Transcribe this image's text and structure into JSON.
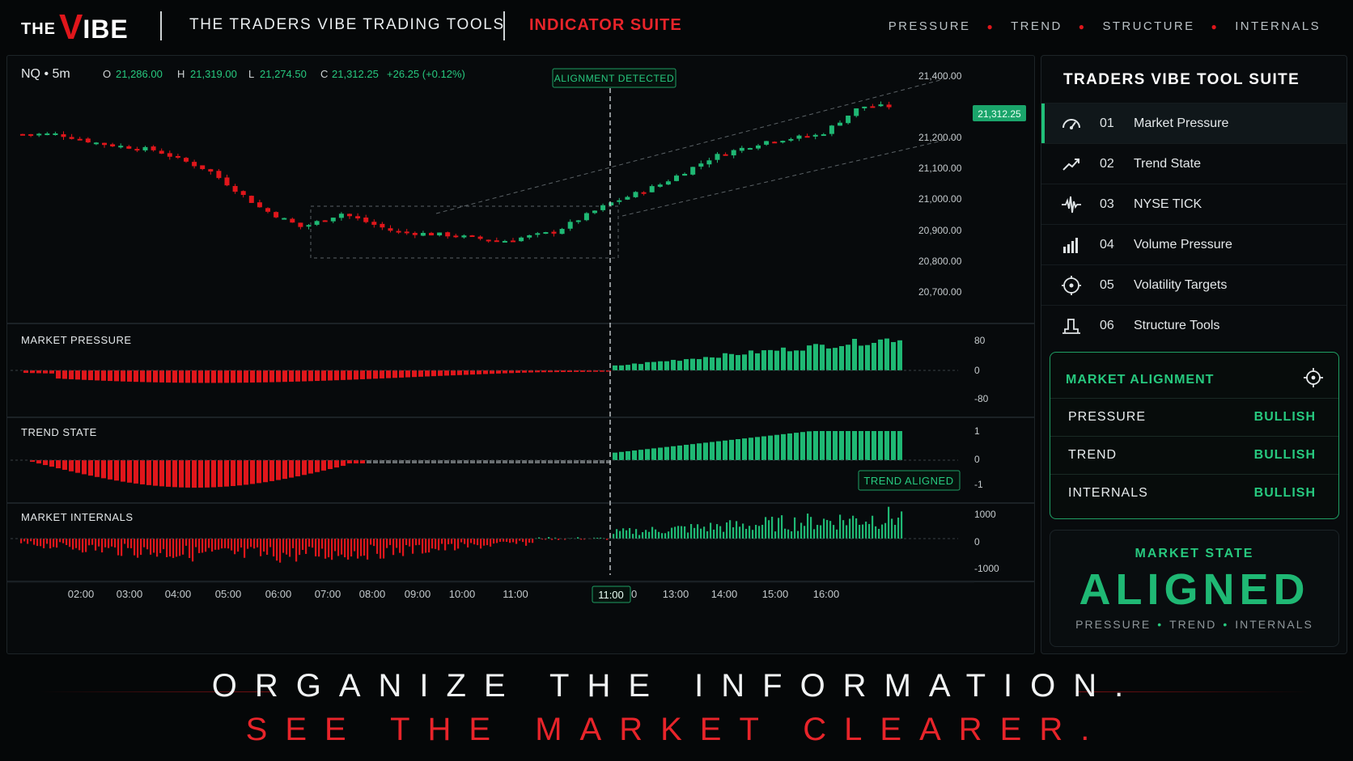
{
  "brand": {
    "logo_the": "THE",
    "logo_v": "V",
    "logo_ibe": "IBE",
    "title": "THE TRADERS VIBE TRADING TOOLS",
    "suite": "INDICATOR SUITE"
  },
  "nav": [
    "PRESSURE",
    "TREND",
    "STRUCTURE",
    "INTERNALS"
  ],
  "chart": {
    "symbol": "NQ • 5m",
    "ohlc": {
      "o_label": "O",
      "o": "21,286.00",
      "h_label": "H",
      "h": "21,319.00",
      "l_label": "L",
      "l": "21,274.50",
      "c_label": "C",
      "c": "21,312.25",
      "change": "+26.25 (+0.12%)"
    },
    "alignment_tag": "ALIGNMENT DETECTED",
    "last_price": "21,312.25",
    "price_ticks": [
      "21,400.00",
      "21,200.00",
      "21,100.00",
      "21,000.00",
      "20,900.00",
      "20,800.00",
      "20,700.00"
    ],
    "time_ticks": [
      "02:00",
      "03:00",
      "04:00",
      "05:00",
      "06:00",
      "07:00",
      "08:00",
      "09:00",
      "10:00",
      "11:00",
      "12:00",
      "13:00",
      "14:00",
      "15:00",
      "16:00"
    ],
    "current_time": "11:00",
    "panels": [
      {
        "title": "MARKET PRESSURE",
        "ticks": [
          "80",
          "0",
          "-80"
        ]
      },
      {
        "title": "TREND STATE",
        "ticks": [
          "1",
          "0",
          "-1"
        ],
        "badge": "TREND ALIGNED"
      },
      {
        "title": "MARKET INTERNALS",
        "ticks": [
          "1000",
          "0",
          "-1000"
        ]
      }
    ],
    "colors": {
      "bull": "#1fb874",
      "bear": "#e0161b",
      "neutral": "#6a6f72"
    }
  },
  "chart_data": {
    "type": "candlestick",
    "symbol": "NQ",
    "interval": "5m",
    "y_range": [
      20700,
      21400
    ],
    "approx_close_path": [
      {
        "time": "01:40",
        "price": 21222
      },
      {
        "time": "02:30",
        "price": 21190
      },
      {
        "time": "03:30",
        "price": 21170
      },
      {
        "time": "04:30",
        "price": 21105
      },
      {
        "time": "05:30",
        "price": 20980
      },
      {
        "time": "06:15",
        "price": 20920
      },
      {
        "time": "07:00",
        "price": 20965
      },
      {
        "time": "08:00",
        "price": 20905
      },
      {
        "time": "09:00",
        "price": 20895
      },
      {
        "time": "10:00",
        "price": 20875
      },
      {
        "time": "11:00",
        "price": 20905
      },
      {
        "time": "12:00",
        "price": 20995
      },
      {
        "time": "13:00",
        "price": 21060
      },
      {
        "time": "14:00",
        "price": 21150
      },
      {
        "time": "15:00",
        "price": 21200
      },
      {
        "time": "16:00",
        "price": 21220
      },
      {
        "time": "16:45",
        "price": 21312
      }
    ]
  },
  "sidebar": {
    "title": "TRADERS VIBE TOOL SUITE",
    "items": [
      {
        "num": "01",
        "label": "Market Pressure",
        "icon": "gauge-icon"
      },
      {
        "num": "02",
        "label": "Trend State",
        "icon": "trend-icon"
      },
      {
        "num": "03",
        "label": "NYSE TICK",
        "icon": "pulse-icon"
      },
      {
        "num": "04",
        "label": "Volume Pressure",
        "icon": "bars-icon"
      },
      {
        "num": "05",
        "label": "Volatility Targets",
        "icon": "target-icon"
      },
      {
        "num": "06",
        "label": "Structure Tools",
        "icon": "structure-icon"
      }
    ],
    "alignment": {
      "title": "MARKET ALIGNMENT",
      "rows": [
        {
          "key": "PRESSURE",
          "value": "BULLISH"
        },
        {
          "key": "TREND",
          "value": "BULLISH"
        },
        {
          "key": "INTERNALS",
          "value": "BULLISH"
        }
      ]
    },
    "state": {
      "title": "MARKET STATE",
      "value": "ALIGNED",
      "sub": [
        "PRESSURE",
        "TREND",
        "INTERNALS"
      ]
    }
  },
  "slogan": {
    "line1": "ORGANIZE THE INFORMATION.",
    "line2": "SEE THE MARKET CLEARER."
  }
}
